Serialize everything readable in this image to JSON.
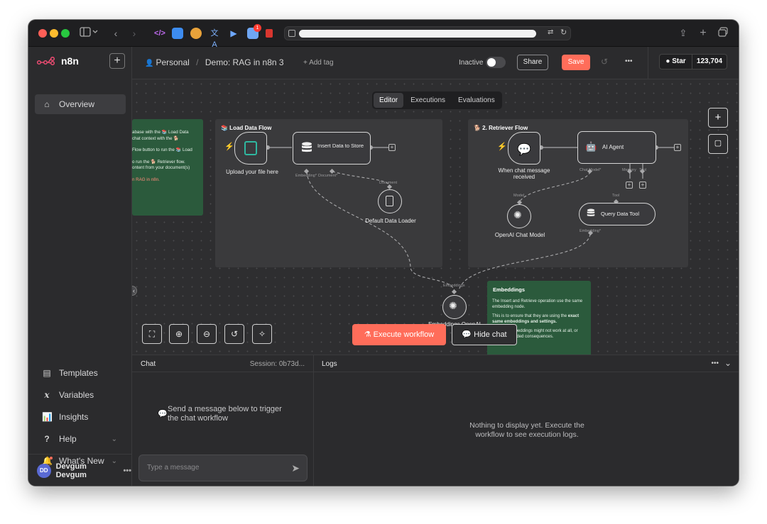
{
  "browser": {
    "accent_colors": {
      "close": "#ff5f57",
      "minimize": "#febc2e",
      "zoom": "#28c840"
    },
    "notification_badge": "1"
  },
  "sidebar": {
    "brand": "n8n",
    "new_button": "+",
    "items": [
      {
        "label": "Overview",
        "icon": "home-icon",
        "active": true
      },
      {
        "label": "Templates",
        "icon": "templates-icon"
      },
      {
        "label": "Variables",
        "icon": "variables-icon"
      },
      {
        "label": "Insights",
        "icon": "insights-icon"
      },
      {
        "label": "Help",
        "icon": "help-icon"
      },
      {
        "label": "What's New",
        "icon": "bell-icon"
      }
    ],
    "user": {
      "initials": "DD",
      "name": "Devgum Devgum",
      "menu": "•••"
    }
  },
  "header": {
    "project": "Personal",
    "separator": "/",
    "workflow_name": "Demo: RAG in n8n 3",
    "add_tag": "+ Add tag",
    "status": "Inactive",
    "share": "Share",
    "save": "Save",
    "more": "•••",
    "github_star": "Star",
    "github_count": "123,704"
  },
  "tabs": [
    "Editor",
    "Executions",
    "Evaluations"
  ],
  "canvas": {
    "stickies": {
      "intro": {
        "lines": [
          "abase with the 📚 Load Data",
          "chat context with the 🐕",
          "",
          "Flow button to run the 📚 Load",
          "",
          "o run the 🐕 Retriever flow.",
          "ontent from your document(s)",
          "",
          "n RAG in n8n."
        ]
      },
      "load": {
        "title": "📚 Load Data Flow"
      },
      "retriever": {
        "title": "🐕 2. Retriever Flow"
      },
      "embeddings": {
        "title": "Embeddings",
        "p1": "The Insert and Retrieve operation use the same embedding node.",
        "p2a": "This is to ensure that they are using the ",
        "p2b": "exact same embeddings and settings.",
        "p3": "Different embeddings might not work at all, or have unintended consequences."
      }
    },
    "nodes": {
      "upload": "Upload your file here",
      "insert": "Insert Data to Store",
      "loader": "Default Data Loader",
      "chat_trigger": "When chat message received",
      "agent": "AI Agent",
      "openai_model": "OpenAI Chat Model",
      "query_tool": "Query Data Tool",
      "embeddings": "Embeddings OpenAI"
    },
    "port_labels": {
      "embedding": "Embedding*",
      "document": "Document*",
      "document2": "Document",
      "chat_model": "Chat Model*",
      "memory": "Memory",
      "tool": "Tool",
      "model": "Model",
      "tool2": "Tool",
      "embedding2": "Embedding*",
      "embeddings": "Embeddings"
    },
    "execute": "Execute workflow",
    "hide_chat": "Hide chat"
  },
  "chat_panel": {
    "title": "Chat",
    "session": "Session: 0b73d...",
    "empty_line1": "Send a message below to trigger",
    "empty_line2": "the chat workflow",
    "placeholder": "Type a message"
  },
  "logs_panel": {
    "title": "Logs",
    "more": "•••",
    "empty_line1": "Nothing to display yet. Execute the",
    "empty_line2": "workflow to see execution logs."
  }
}
